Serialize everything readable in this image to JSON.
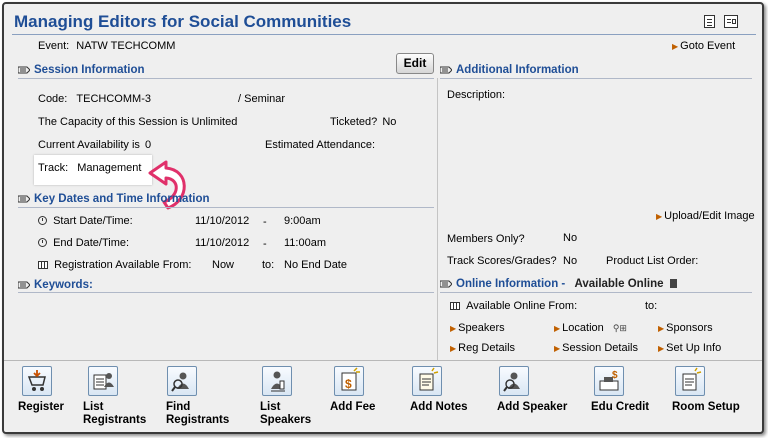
{
  "title": "Managing Editors for Social Communities",
  "header_icons": [
    "document-icon",
    "print-preview-icon"
  ],
  "event": {
    "label": "Event:",
    "value": "NATW TECHCOMM"
  },
  "goto_event": "Goto Event",
  "edit_label": "Edit",
  "session": {
    "heading": "Session Information",
    "code_label": "Code:",
    "code_value": "TECHCOMM-3",
    "type_value": "/ Seminar",
    "capacity_text": "The Capacity of this Session is Unlimited",
    "ticketed_label": "Ticketed?",
    "ticketed_value": "No",
    "availability_label": "Current Availability is",
    "availability_value": "0",
    "estimated_label": "Estimated Attendance:",
    "track_label": "Track:",
    "track_value": "Management"
  },
  "dates": {
    "heading": "Key Dates and Time Information",
    "start_label": "Start Date/Time:",
    "start_date": "11/10/2012",
    "start_time": "9:00am",
    "end_label": "End Date/Time:",
    "end_date": "11/10/2012",
    "end_time": "11:00am",
    "dash": "-",
    "reg_label": "Registration Available From:",
    "reg_from": "Now",
    "reg_to_label": "to:",
    "reg_to": "No End Date"
  },
  "keywords": {
    "heading": "Keywords:"
  },
  "additional": {
    "heading": "Additional Information",
    "description_label": "Description:",
    "upload_image": "Upload/Edit Image",
    "members_label": "Members Only?",
    "members_value": "No",
    "track_scores_label": "Track Scores/Grades?",
    "track_scores_value": "No",
    "product_list_label": "Product List Order:"
  },
  "online": {
    "heading": "Online Information -",
    "status": "Available Online",
    "from_label": "Available Online From:",
    "to_label": "to:",
    "links": [
      "Speakers",
      "Location",
      "Sponsors",
      "Reg Details",
      "Session Details",
      "Set Up Info"
    ]
  },
  "toolbar": [
    {
      "name": "register",
      "label": "Register"
    },
    {
      "name": "list-registrants",
      "label": "List Registrants"
    },
    {
      "name": "find-registrants",
      "label": "Find Registrants"
    },
    {
      "name": "list-speakers",
      "label": "List Speakers"
    },
    {
      "name": "add-fee",
      "label": "Add Fee"
    },
    {
      "name": "add-notes",
      "label": "Add Notes"
    },
    {
      "name": "add-speaker",
      "label": "Add Speaker"
    },
    {
      "name": "edu-credit",
      "label": "Edu Credit"
    },
    {
      "name": "room-setup",
      "label": "Room Setup"
    }
  ],
  "colors": {
    "title": "#1f4e96",
    "section": "#1f4e96",
    "link_arrow": "#c06000",
    "callout_arrow": "#e0306a"
  }
}
